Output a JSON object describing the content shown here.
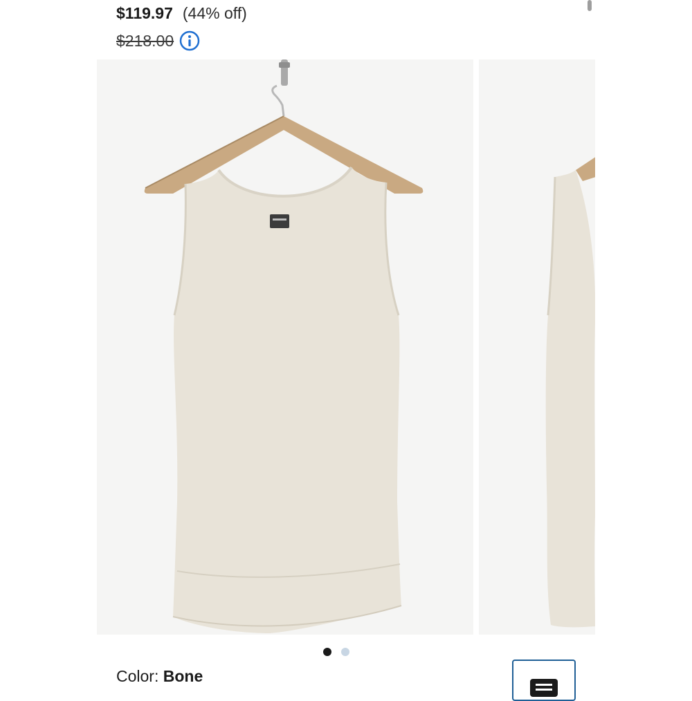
{
  "product": {
    "sale_price": "$119.97",
    "discount": "(44% off)",
    "original_price": "$218.00",
    "color_label": "Color:",
    "color_value": "Bone"
  },
  "carousel": {
    "total_slides": 2,
    "active_slide": 1,
    "image_alt_1": "Sleeveless tank top on hanger, front view",
    "image_alt_2": "Sleeveless tank top on hanger, side view"
  },
  "icons": {
    "info": "info-icon",
    "size_guide": "list-icon"
  },
  "colors": {
    "accent": "#1f5f96",
    "info_icon": "#1f6fd1",
    "garment": "#e8e3d8",
    "background": "#f5f5f4",
    "dot_active": "#1a1a1a",
    "dot_inactive": "#c8d6e4"
  }
}
